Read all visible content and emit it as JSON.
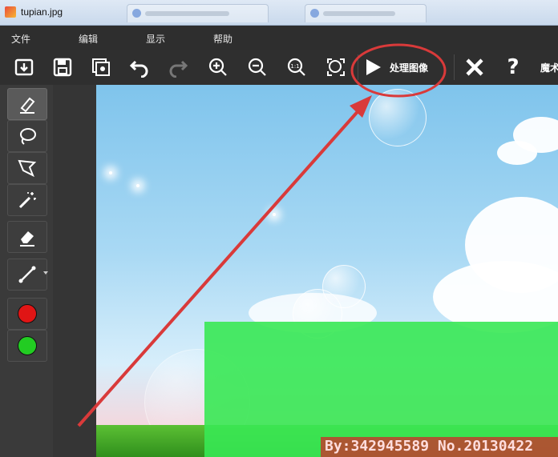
{
  "window": {
    "title": "tupian.jpg"
  },
  "menu": {
    "items": [
      "文件",
      "编辑",
      "显示",
      "帮助"
    ]
  },
  "toolbar": {
    "process_label": "处理图像",
    "cut_label": "魔术",
    "help_label": "?"
  },
  "canvas": {
    "watermark": "By:342945589  No.20130422"
  },
  "colors": {
    "accent_red": "#e02020",
    "accent_green": "#22cc33",
    "annotation": "#d93a3a",
    "overlay_green": "#39e854"
  }
}
